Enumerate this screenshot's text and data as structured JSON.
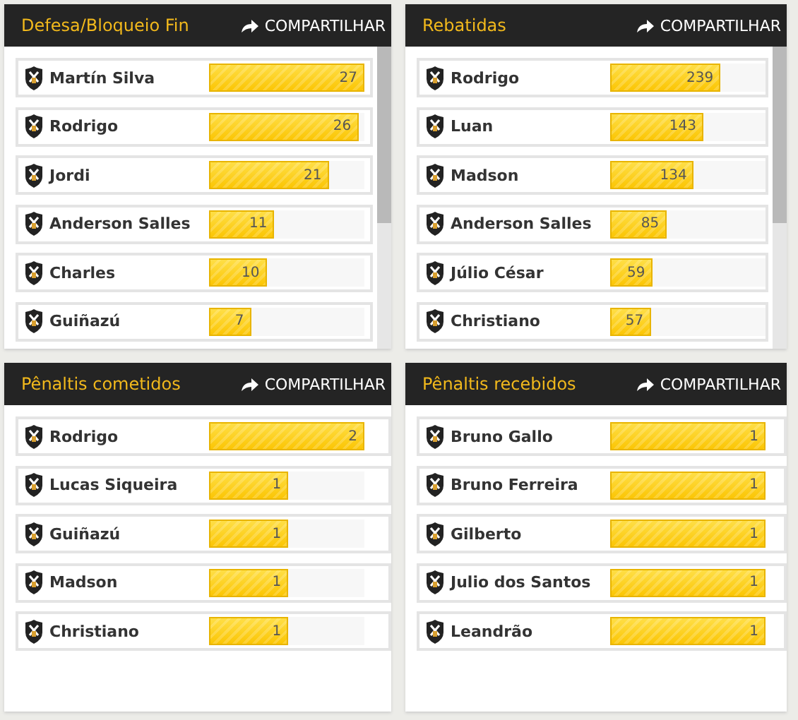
{
  "panels": [
    {
      "title": "Defesa/Bloqueio Fin",
      "share": "COMPARTILHAR",
      "scrollable": true,
      "rows": [
        {
          "name": "Martín Silva",
          "value": "27",
          "level": 1.0
        },
        {
          "name": "Rodrigo",
          "value": "26",
          "level": 0.96
        },
        {
          "name": "Jordi",
          "value": "21",
          "level": 0.77
        },
        {
          "name": "Anderson Salles",
          "value": "11",
          "level": 0.42
        },
        {
          "name": "Charles",
          "value": "10",
          "level": 0.37
        },
        {
          "name": "Guiñazú",
          "value": "7",
          "level": 0.27
        }
      ]
    },
    {
      "title": "Rebatidas",
      "share": "COMPARTILHAR",
      "scrollable": true,
      "rows": [
        {
          "name": "Rodrigo",
          "value": "239",
          "level": 0.71
        },
        {
          "name": "Luan",
          "value": "143",
          "level": 0.6
        },
        {
          "name": "Madson",
          "value": "134",
          "level": 0.54
        },
        {
          "name": "Anderson Salles",
          "value": "85",
          "level": 0.36
        },
        {
          "name": "Júlio César",
          "value": "59",
          "level": 0.27
        },
        {
          "name": "Christiano",
          "value": "57",
          "level": 0.26
        }
      ]
    },
    {
      "title": "Pênaltis cometidos",
      "share": "COMPARTILHAR",
      "scrollable": false,
      "rows": [
        {
          "name": "Rodrigo",
          "value": "2",
          "level": 1.0
        },
        {
          "name": "Lucas Siqueira",
          "value": "1",
          "level": 0.51
        },
        {
          "name": "Guiñazú",
          "value": "1",
          "level": 0.51
        },
        {
          "name": "Madson",
          "value": "1",
          "level": 0.51
        },
        {
          "name": "Christiano",
          "value": "1",
          "level": 0.51
        }
      ]
    },
    {
      "title": "Pênaltis recebidos",
      "share": "COMPARTILHAR",
      "scrollable": false,
      "rows": [
        {
          "name": "Bruno Gallo",
          "value": "1",
          "level": 1.0
        },
        {
          "name": "Bruno Ferreira",
          "value": "1",
          "level": 1.0
        },
        {
          "name": "Gilberto",
          "value": "1",
          "level": 1.0
        },
        {
          "name": "Julio dos Santos",
          "value": "1",
          "level": 1.0
        },
        {
          "name": "Leandrão",
          "value": "1",
          "level": 1.0
        }
      ]
    }
  ]
}
